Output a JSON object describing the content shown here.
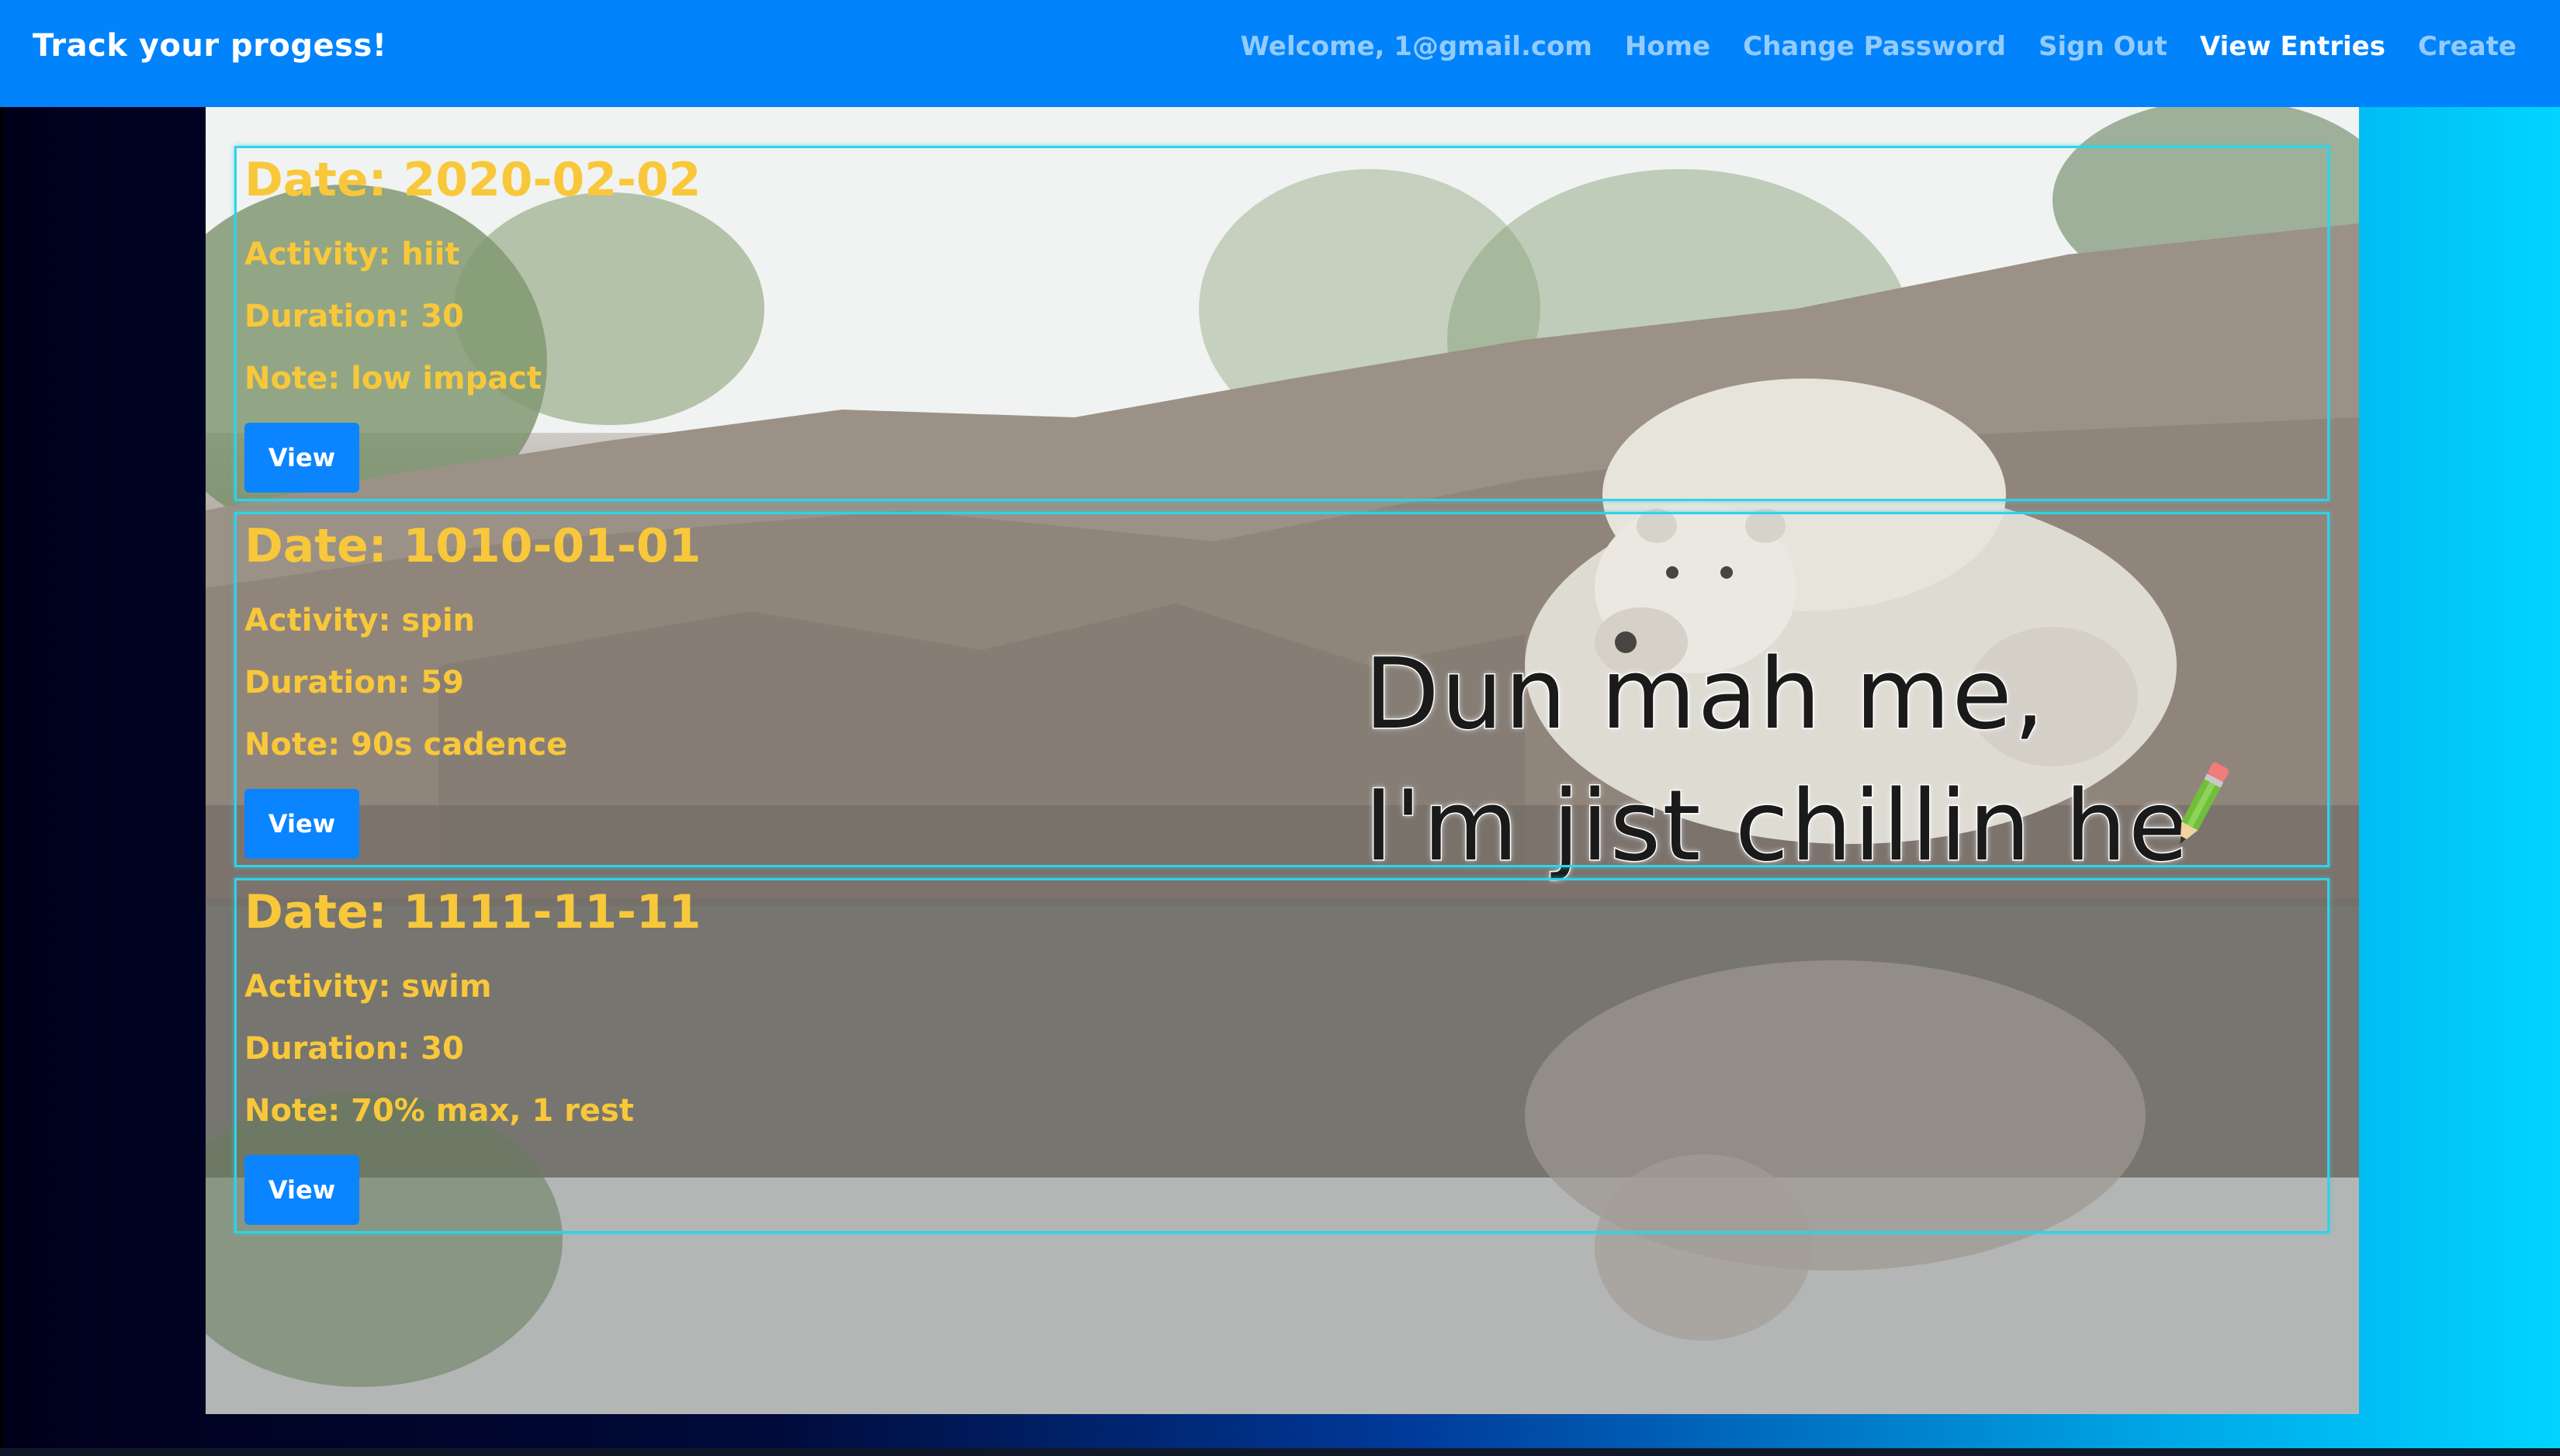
{
  "navbar": {
    "brand": "Track your progess!",
    "links": [
      {
        "label": "Welcome, 1@gmail.com"
      },
      {
        "label": "Home"
      },
      {
        "label": "Change Password"
      },
      {
        "label": "Sign Out"
      },
      {
        "label": "View Entries"
      },
      {
        "label": "Create"
      }
    ],
    "active": "View Entries"
  },
  "entries": [
    {
      "date": "Date: 2020-02-02",
      "activity": "Activity: hiit",
      "duration": "Duration: 30",
      "note": "Note: low impact",
      "button": "View"
    },
    {
      "date": "Date: 1010-01-01",
      "activity": "Activity: spin",
      "duration": "Duration: 59",
      "note": "Note: 90s cadence",
      "button": "View"
    },
    {
      "date": "Date: 1111-11-11",
      "activity": "Activity: swim",
      "duration": "Duration: 30",
      "note": "Note: 70% max, 1 rest",
      "button": "View"
    }
  ],
  "background_caption": {
    "line1": "Dun mah me,",
    "line2": "I'm jist chillin he"
  },
  "colors": {
    "navbar": "#0183fb",
    "entry_text": "#f8c83a",
    "entry_border": "#2fd3e8",
    "button": "#0a84ff"
  },
  "icons": {
    "pencil": "pencil-icon"
  }
}
